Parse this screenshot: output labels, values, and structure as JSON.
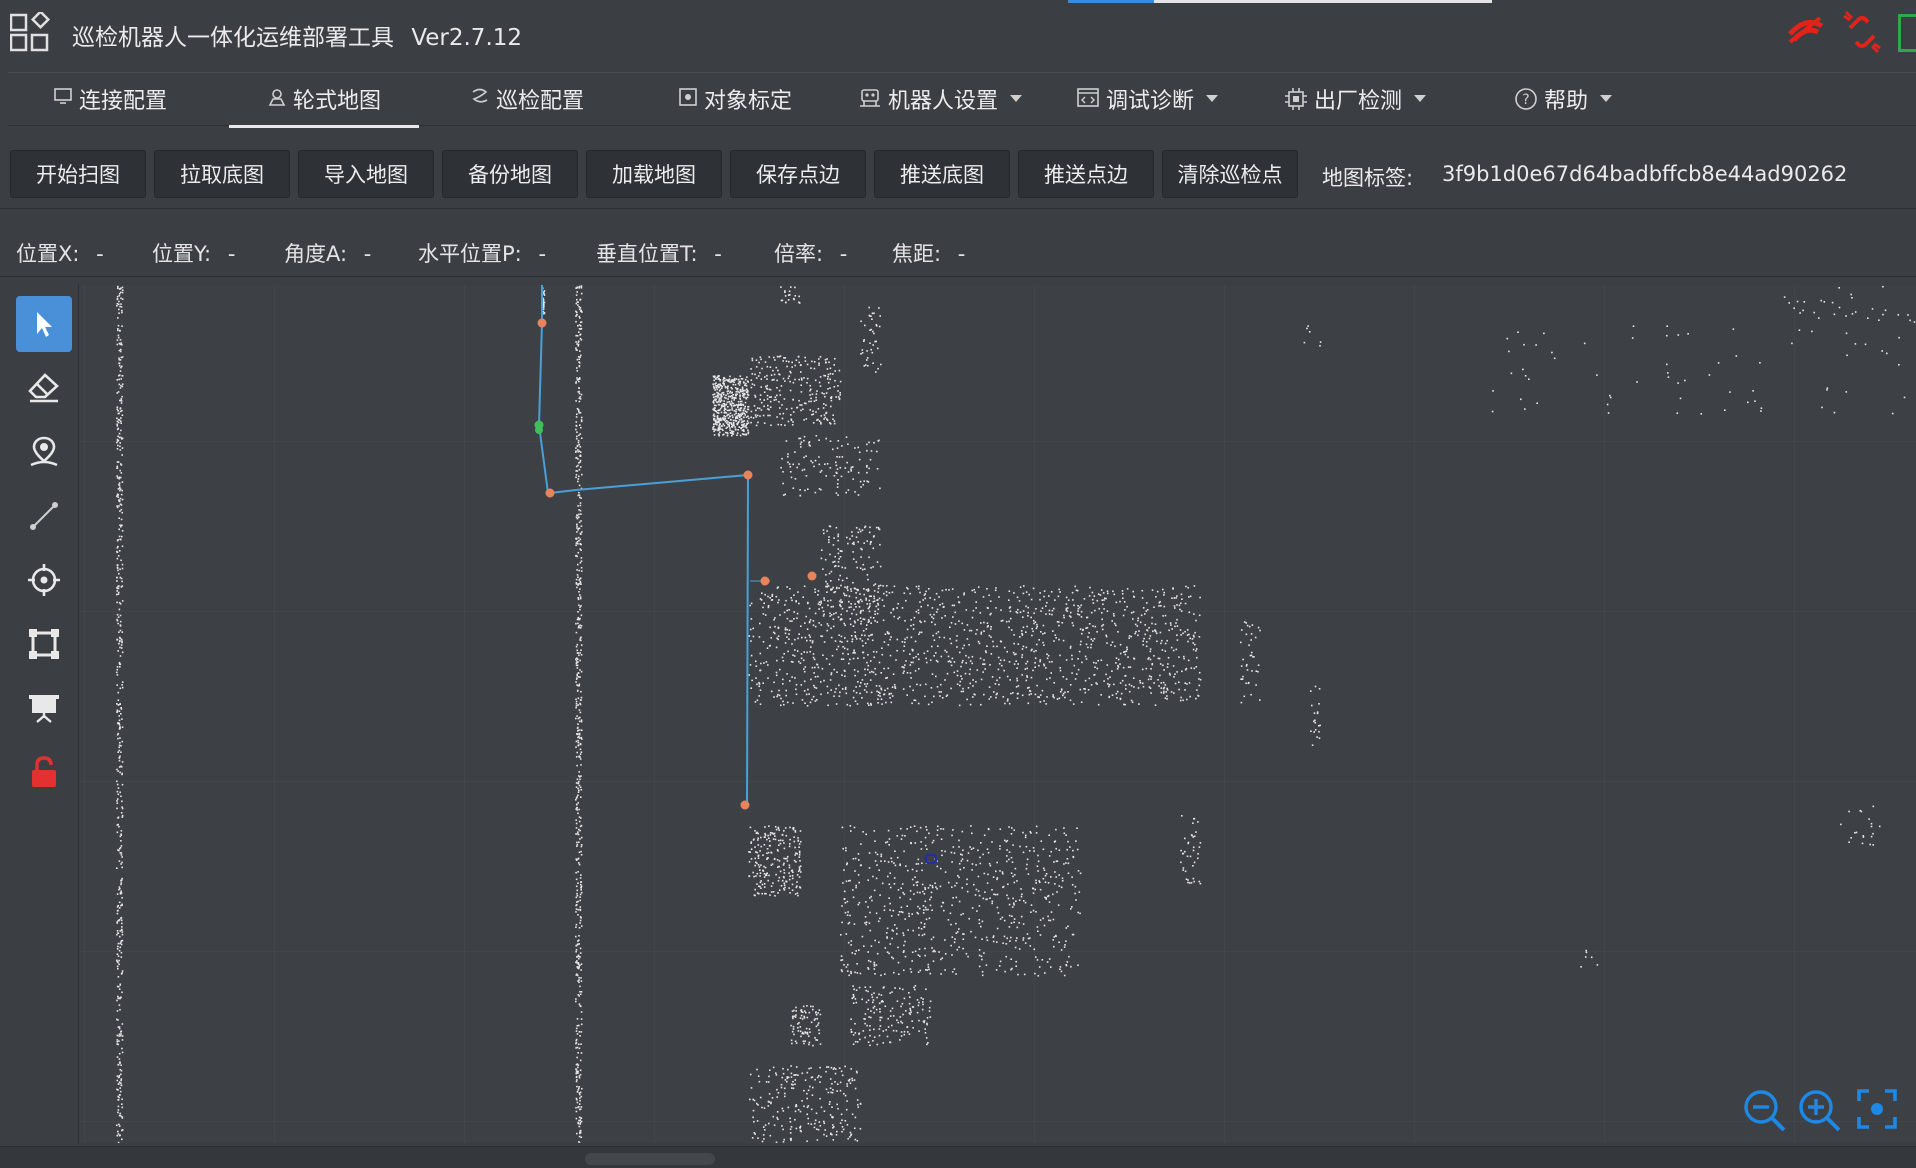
{
  "app": {
    "title": "巡检机器人一体化运维部署工具",
    "version": "Ver2.7.12"
  },
  "nav": {
    "tabs": [
      {
        "label": "连接配置",
        "icon": "monitor-icon",
        "dropdown": false
      },
      {
        "label": "轮式地图",
        "icon": "map-icon",
        "dropdown": false,
        "active": true
      },
      {
        "label": "巡检配置",
        "icon": "route-icon",
        "dropdown": false
      },
      {
        "label": "对象标定",
        "icon": "target-frame-icon",
        "dropdown": false
      },
      {
        "label": "机器人设置",
        "icon": "robot-icon",
        "dropdown": true
      },
      {
        "label": "调试诊断",
        "icon": "code-window-icon",
        "dropdown": true
      },
      {
        "label": "出厂检测",
        "icon": "chip-icon",
        "dropdown": true
      },
      {
        "label": "帮助",
        "icon": "help-icon",
        "dropdown": true
      }
    ]
  },
  "toolbar": {
    "buttons": [
      "开始扫图",
      "拉取底图",
      "导入地图",
      "备份地图",
      "加载地图",
      "保存点边",
      "推送底图",
      "推送点边",
      "清除巡检点"
    ],
    "map_tag_label": "地图标签:",
    "map_tag_value": "3f9b1d0e67d64badbffcb8e44ad90262"
  },
  "status": {
    "fields": [
      {
        "label": "位置X:",
        "value": "-"
      },
      {
        "label": "位置Y:",
        "value": "-"
      },
      {
        "label": "角度A:",
        "value": "-"
      },
      {
        "label": "水平位置P:",
        "value": "-"
      },
      {
        "label": "垂直位置T:",
        "value": "-"
      },
      {
        "label": "倍率:",
        "value": "-"
      },
      {
        "label": "焦距:",
        "value": "-"
      }
    ]
  },
  "tools": [
    {
      "name": "select-pointer-icon",
      "active": true
    },
    {
      "name": "eraser-icon"
    },
    {
      "name": "location-pin-icon"
    },
    {
      "name": "line-edge-icon"
    },
    {
      "name": "crosshair-icon"
    },
    {
      "name": "rectangle-select-icon"
    },
    {
      "name": "presentation-board-icon"
    },
    {
      "name": "lock-icon"
    }
  ],
  "zoom_controls": [
    "zoom-out-icon",
    "zoom-in-icon",
    "fit-view-icon"
  ],
  "colors": {
    "background": "#3b3f44",
    "map_background": "#3d4146",
    "accent_blue": "#4a90d9",
    "path_line": "#4a9fd6",
    "waypoint": "#e8845c",
    "waypoint_green": "#3fbf5a",
    "lock_red": "#e53030",
    "status_red": "#e2231a"
  }
}
